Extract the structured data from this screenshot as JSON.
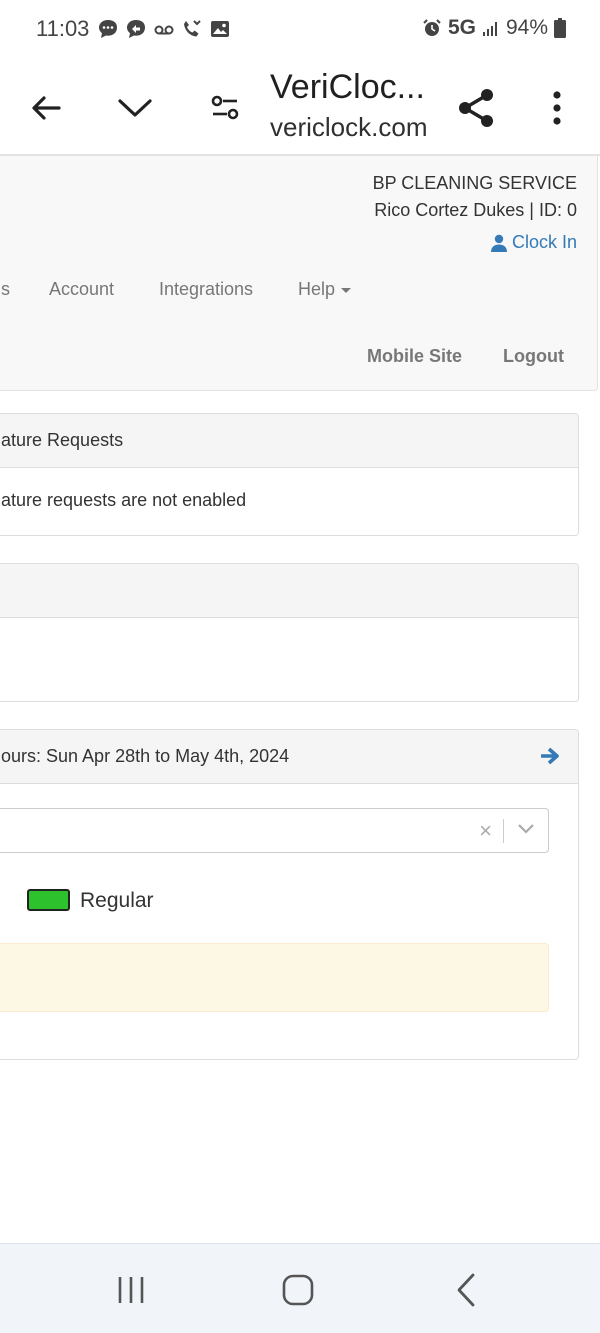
{
  "status_bar": {
    "time": "11:03",
    "network": "5G",
    "battery": "94%",
    "notification_icons": [
      "chat-bubble-icon",
      "messenger-icon",
      "voicemail-icon",
      "missed-call-icon",
      "image-icon"
    ]
  },
  "browser": {
    "page_title": "VeriCloc...",
    "url": "vericlock.com"
  },
  "header": {
    "company": "BP CLEANING SERVICE",
    "user_line": "Rico Cortez Dukes | ID: 0",
    "clock_in": "Clock In"
  },
  "nav": {
    "partial_item": "s",
    "account": "Account",
    "integrations": "Integrations",
    "help": "Help",
    "mobile_site": "Mobile Site",
    "logout": "Logout"
  },
  "signature_panel": {
    "heading": "nature Requests",
    "body": "nature requests are not enabled"
  },
  "hours_panel": {
    "heading": "ours: Sun Apr 28th to May 4th, 2024",
    "legend_label": "Regular",
    "clear_symbol": "×"
  },
  "colors": {
    "link": "#337ab7",
    "regular_swatch": "#2ec12e",
    "warning_bg": "#fcf8e3"
  }
}
